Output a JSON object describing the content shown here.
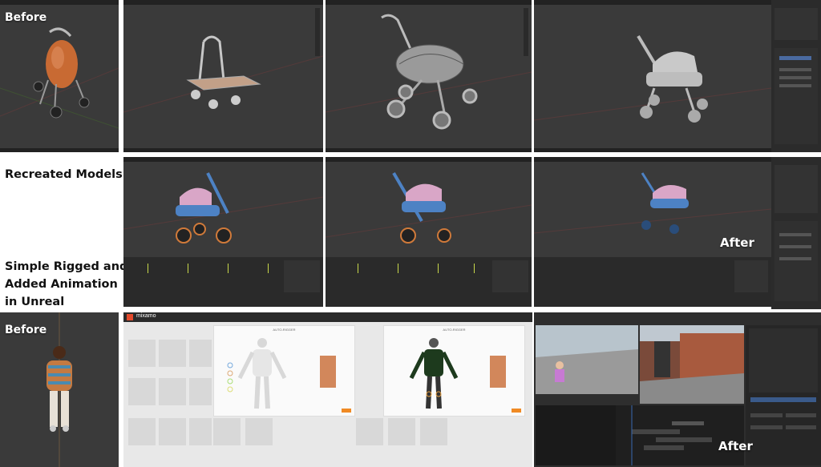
{
  "labels": {
    "before_top": "Before",
    "recreated": "Recreated Models",
    "rigged_line1": "Simple Rigged and",
    "rigged_line2": "Added Animation",
    "rigged_line3": "in Unreal",
    "after_top": "After",
    "before_bottom": "Before",
    "after_bottom": "After"
  },
  "mixamo": {
    "app_name": "mixamo",
    "dialog_title": "AUTO-RIGGER"
  },
  "colors": {
    "blender_bg": "#3a3a3a",
    "stroller_orange": "#c86a33",
    "stroller_pink": "#d9a6c7",
    "stroller_blue": "#4d82c4",
    "keyframe": "#c8d84a",
    "mixamo_accent": "#f08a24"
  }
}
